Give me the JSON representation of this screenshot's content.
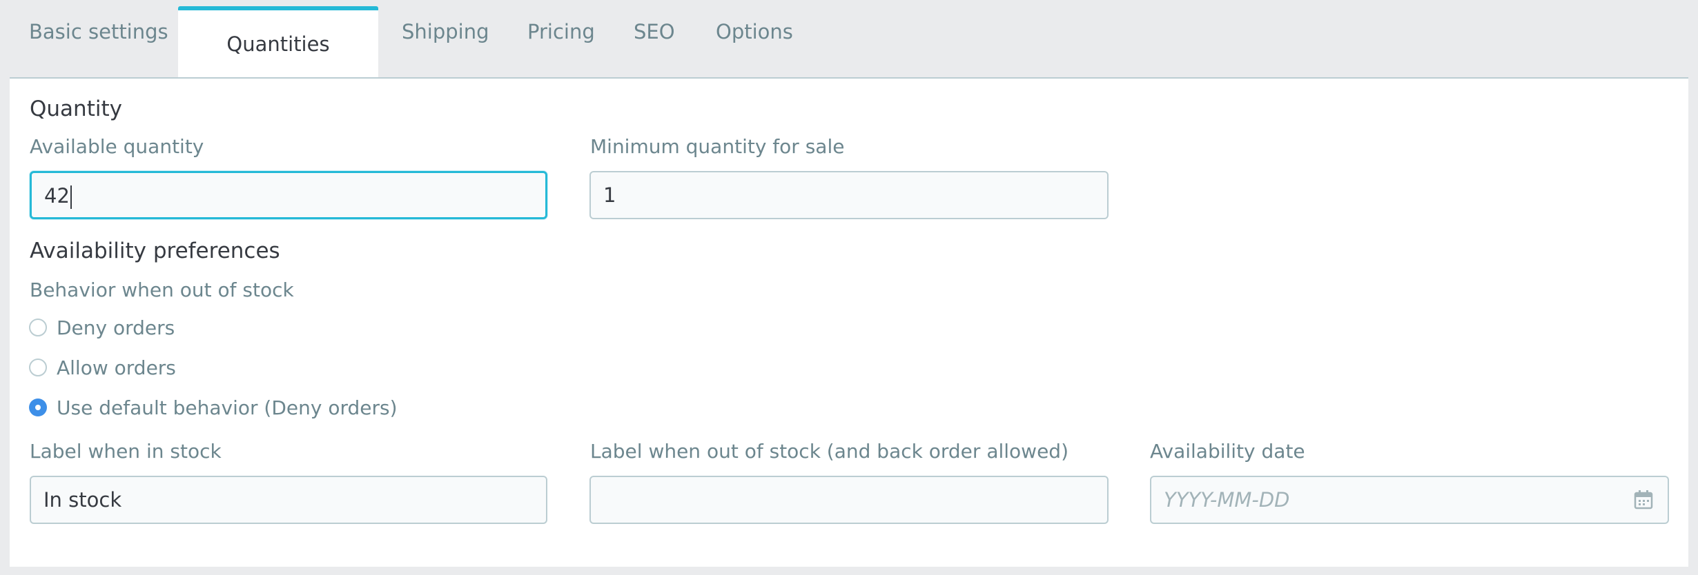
{
  "tabs": [
    {
      "label": "Basic settings",
      "active": false
    },
    {
      "label": "Quantities",
      "active": true
    },
    {
      "label": "Shipping",
      "active": false
    },
    {
      "label": "Pricing",
      "active": false
    },
    {
      "label": "SEO",
      "active": false
    },
    {
      "label": "Options",
      "active": false
    }
  ],
  "quantity_section": {
    "title": "Quantity",
    "available_label": "Available quantity",
    "available_value": "42",
    "minimum_label": "Minimum quantity for sale",
    "minimum_value": "1"
  },
  "availability_section": {
    "title": "Availability preferences",
    "behavior_label": "Behavior when out of stock",
    "options": [
      {
        "label": "Deny orders",
        "checked": false
      },
      {
        "label": "Allow orders",
        "checked": false
      },
      {
        "label": "Use default behavior (Deny orders)",
        "checked": true
      }
    ],
    "in_stock_label": "Label when in stock",
    "in_stock_value": "In stock",
    "out_of_stock_label": "Label when out of stock (and back order allowed)",
    "out_of_stock_value": "",
    "date_label": "Availability date",
    "date_placeholder": "YYYY-MM-DD"
  },
  "colors": {
    "accent": "#25b9d7",
    "radio_checked": "#3d8fe8",
    "label_text": "#6c868e",
    "border": "#bbcdd2"
  },
  "icons": {
    "date_picker": "calendar-icon"
  }
}
